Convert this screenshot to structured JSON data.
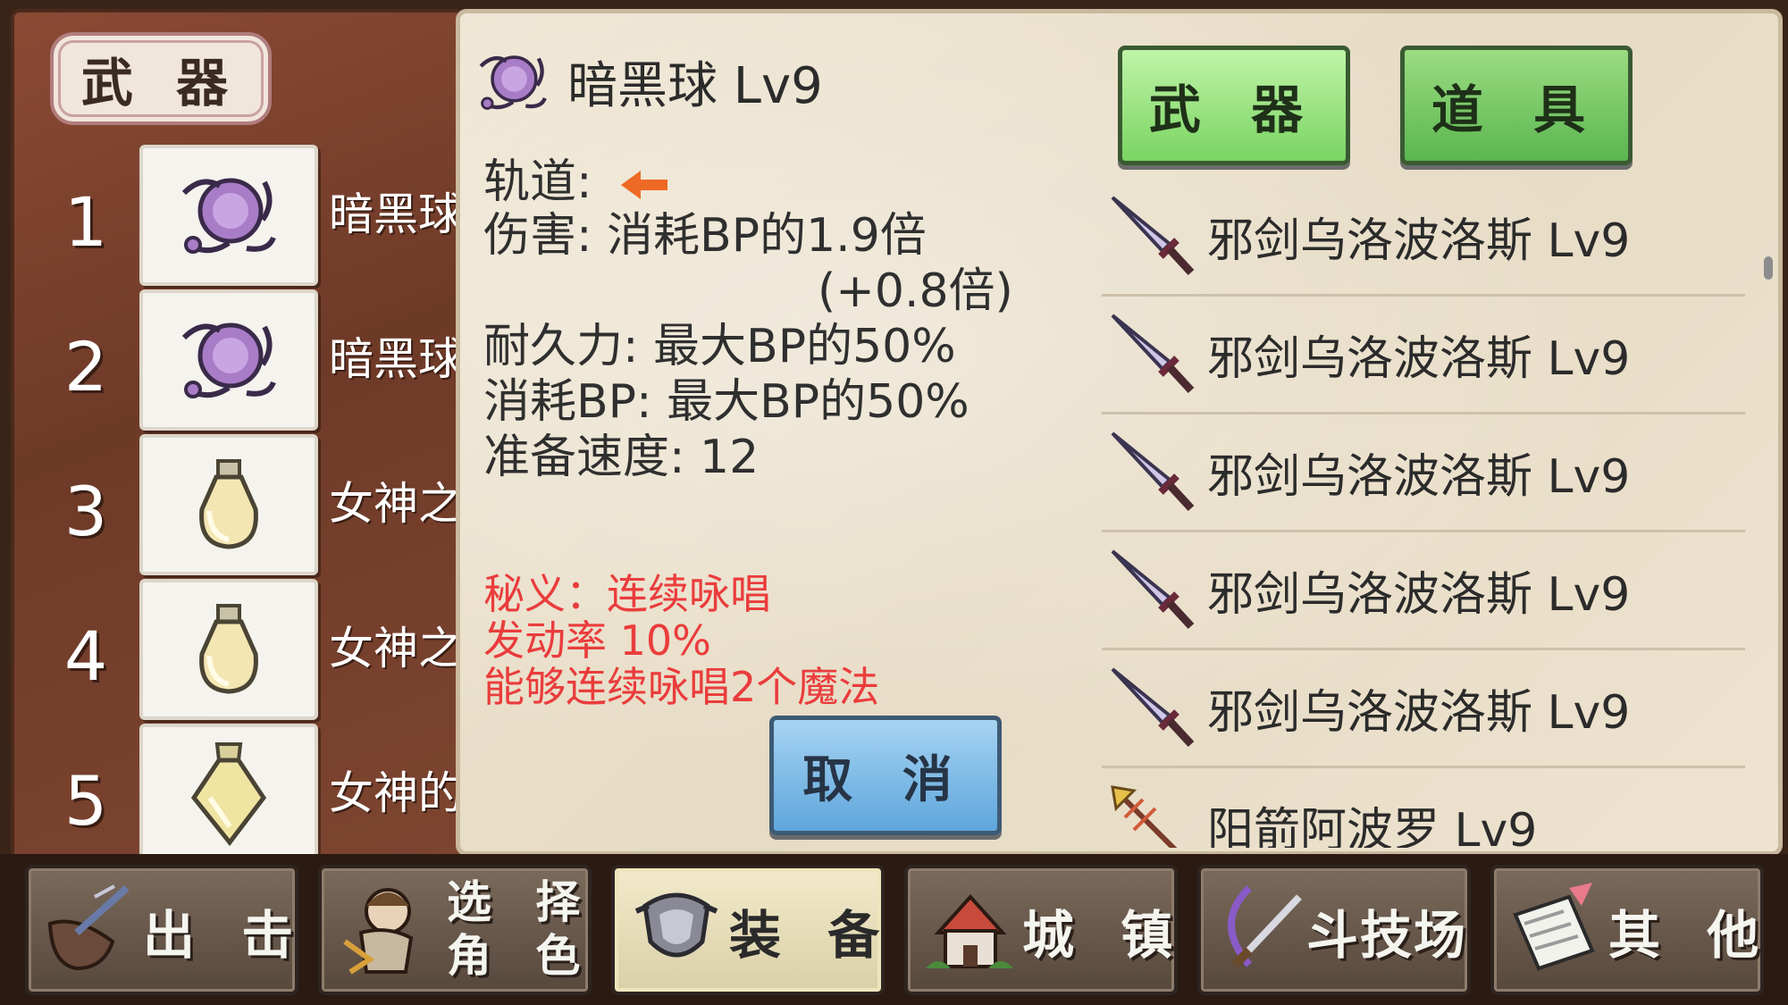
{
  "left_panel": {
    "title": "武 器",
    "slots": [
      {
        "num": "1",
        "name": "暗黑球",
        "icon": "dark-orb-icon"
      },
      {
        "num": "2",
        "name": "暗黑球",
        "icon": "dark-orb-icon"
      },
      {
        "num": "3",
        "name": "女神之",
        "icon": "potion-bottle-icon"
      },
      {
        "num": "4",
        "name": "女神之",
        "icon": "potion-bottle-icon"
      },
      {
        "num": "5",
        "name": "女神的",
        "icon": "elixir-flask-icon"
      }
    ]
  },
  "detail": {
    "title": "暗黑球 Lv9",
    "icon": "dark-orb-icon",
    "track_label": "轨道:",
    "damage": "伤害: 消耗BP的1.9倍",
    "damage_bonus": "(+0.8倍)",
    "durability": "耐久力: 最大BP的50%",
    "bp_cost": "消耗BP: 最大BP的50%",
    "prep_speed": "准备速度: 12",
    "special_name": "秘义：连续咏唱",
    "special_rate": "发动率 10%",
    "special_desc": "能够连续咏唱2个魔法",
    "cancel_label": "取 消"
  },
  "tabs": {
    "weapon_label": "武 器",
    "item_label": "道 具"
  },
  "weapon_list": [
    {
      "label": "邪剑乌洛波洛斯 Lv9",
      "icon": "sword-icon"
    },
    {
      "label": "邪剑乌洛波洛斯 Lv9",
      "icon": "sword-icon"
    },
    {
      "label": "邪剑乌洛波洛斯 Lv9",
      "icon": "sword-icon"
    },
    {
      "label": "邪剑乌洛波洛斯 Lv9",
      "icon": "sword-icon"
    },
    {
      "label": "邪剑乌洛波洛斯 Lv9",
      "icon": "sword-icon"
    },
    {
      "label": "阳箭阿波罗 Lv9",
      "icon": "arrow-icon"
    }
  ],
  "nav": [
    {
      "label": "出 击",
      "icon": "sortie-icon"
    },
    {
      "label": "选择角色",
      "line1": "选 择",
      "line2": "角 色",
      "icon": "character-select-icon"
    },
    {
      "label": "装 备",
      "icon": "armor-icon",
      "active": true
    },
    {
      "label": "城 镇",
      "icon": "town-icon"
    },
    {
      "label": "斗技场",
      "icon": "arena-icon"
    },
    {
      "label": "其 他",
      "icon": "other-icon"
    }
  ],
  "colors": {
    "special_text": "#ea3c3c",
    "track_arrow": "#ee6a24",
    "tab_green": "#7ad462",
    "cancel_blue": "#5ea6dc"
  }
}
